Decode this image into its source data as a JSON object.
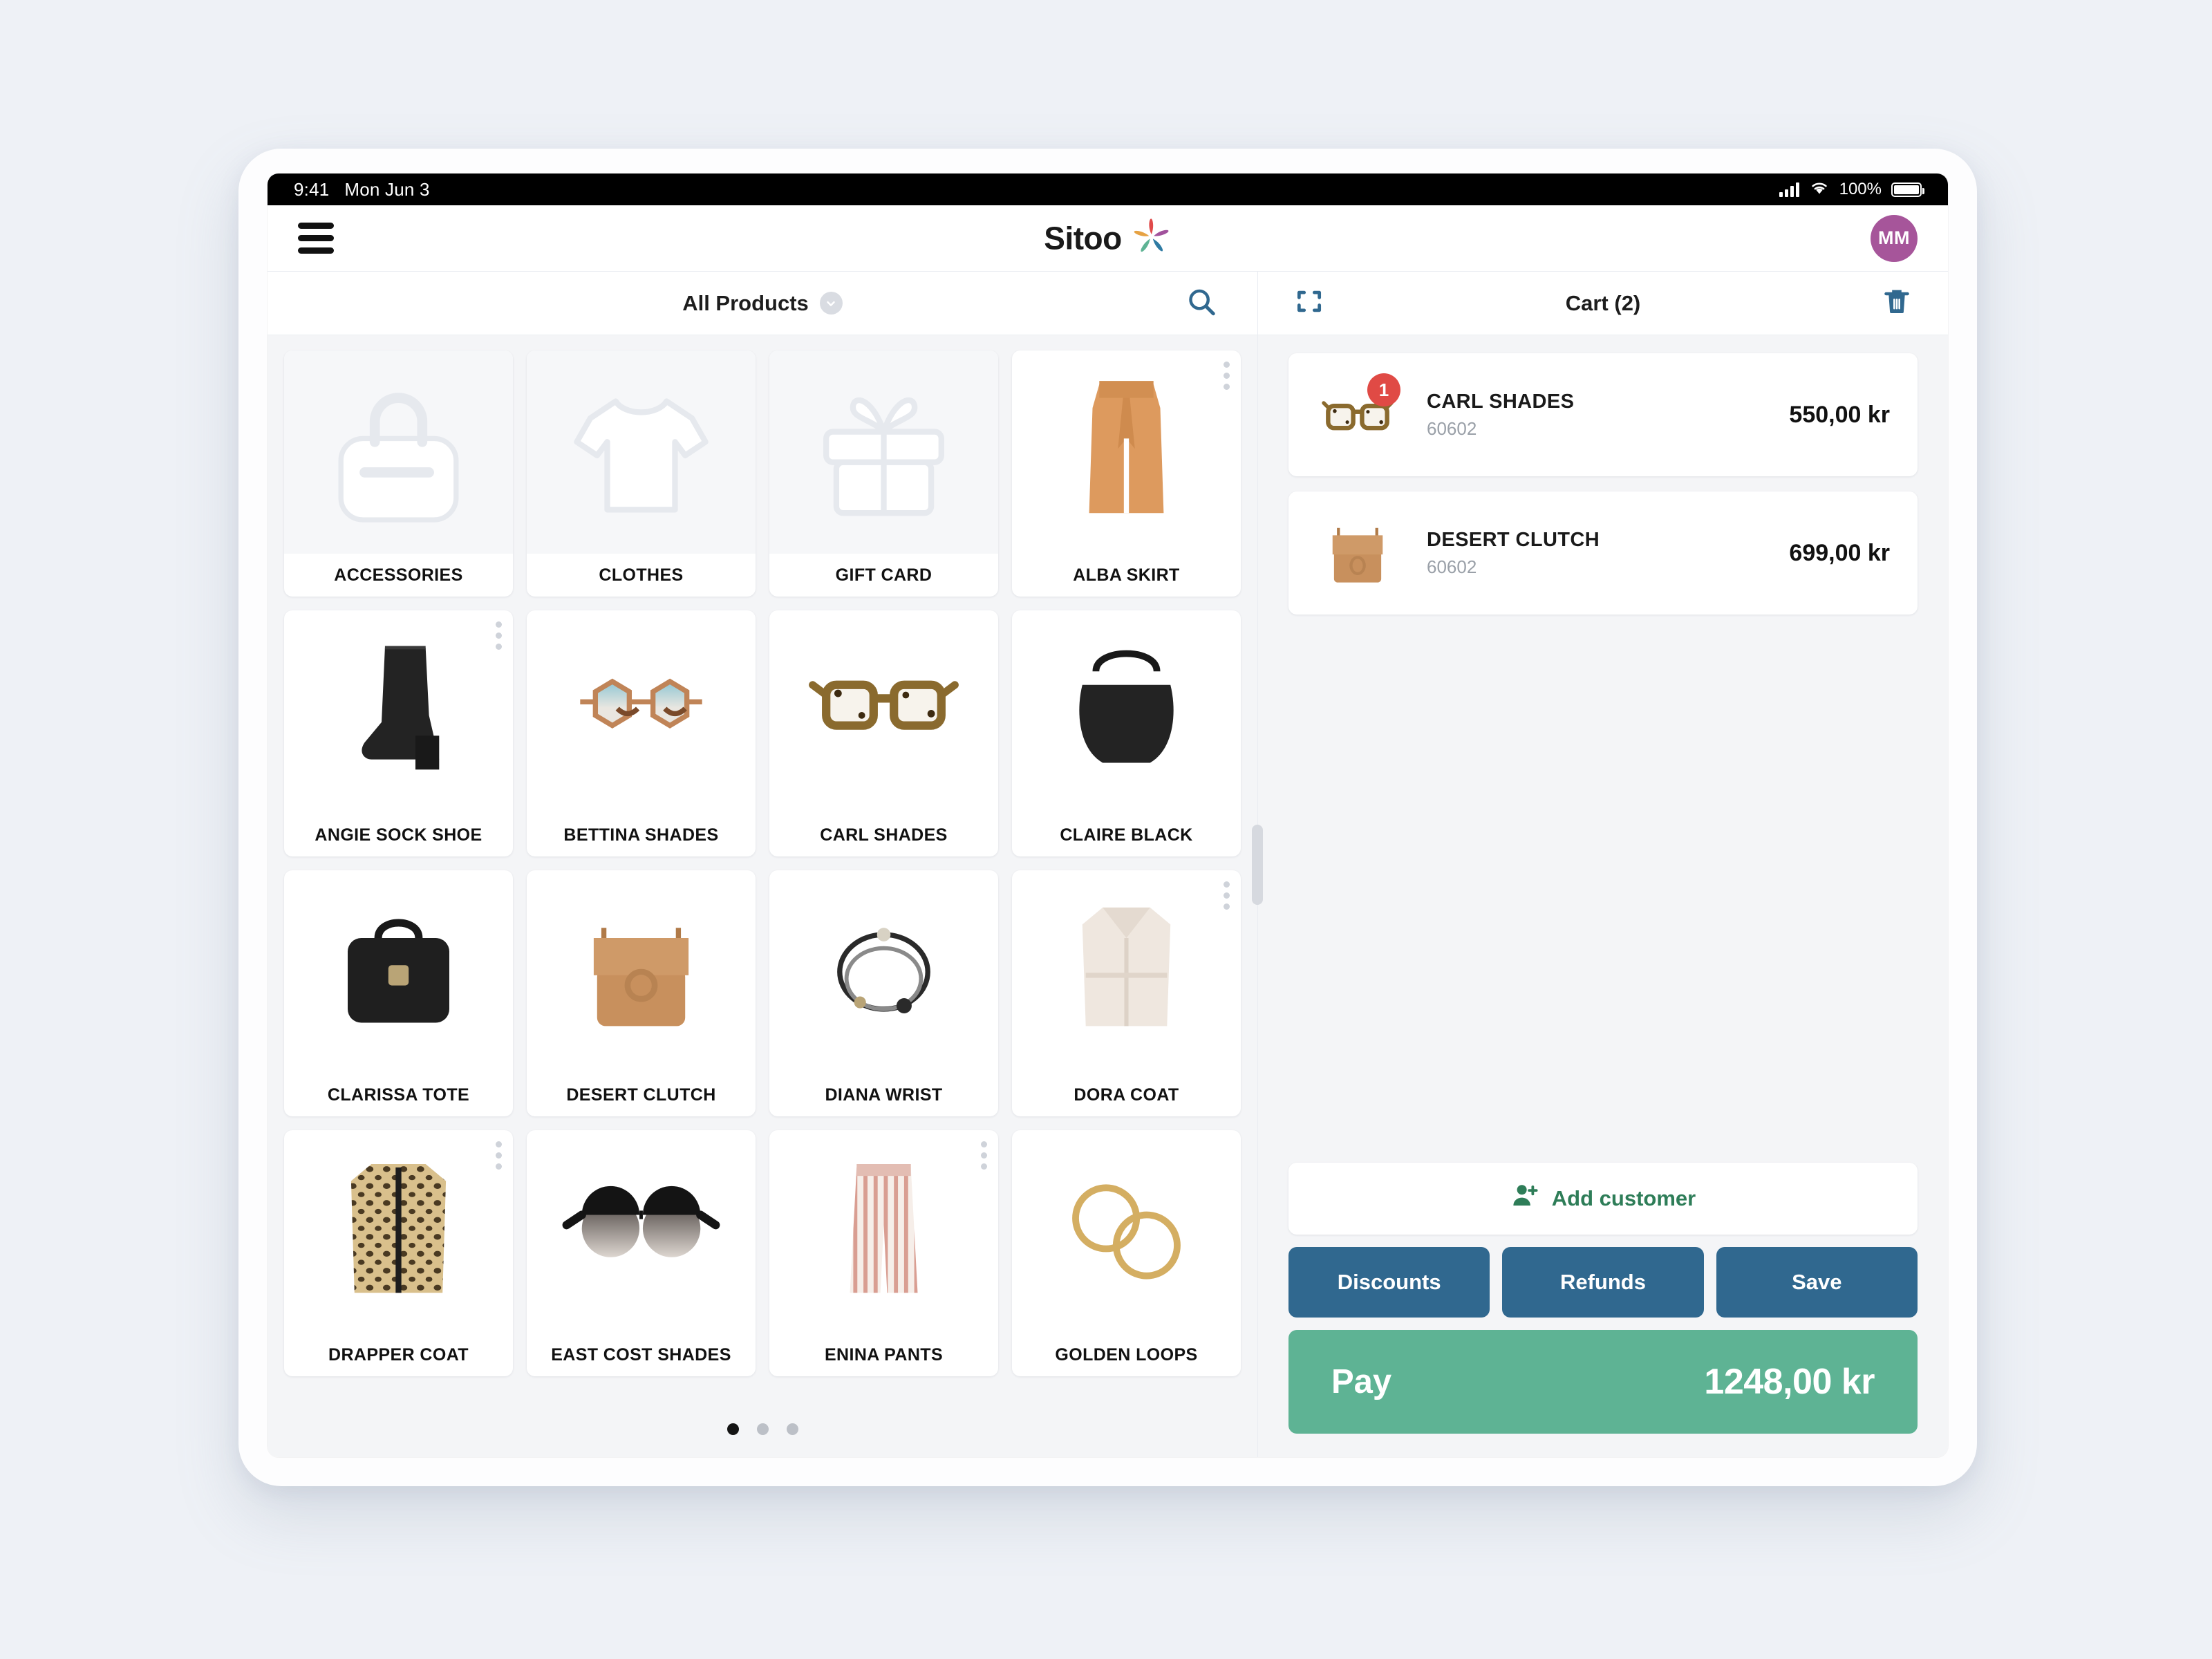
{
  "status_bar": {
    "time": "9:41",
    "date": "Mon Jun 3",
    "battery_percent": "100%"
  },
  "top_nav": {
    "brand_name": "Sitoo",
    "avatar_initials": "MM"
  },
  "product_panel": {
    "filter_label": "All Products",
    "products": [
      {
        "label": "ACCESSORIES",
        "kind": "category",
        "art": "handbag-placeholder"
      },
      {
        "label": "CLOTHES",
        "kind": "category",
        "art": "tshirt-placeholder"
      },
      {
        "label": "GIFT CARD",
        "kind": "category",
        "art": "gift-placeholder"
      },
      {
        "label": "ALBA SKIRT",
        "kind": "product",
        "art": "orange-skirt"
      },
      {
        "label": "ANGIE SOCK SHOE",
        "kind": "product",
        "art": "black-boot"
      },
      {
        "label": "BETTINA SHADES",
        "kind": "product",
        "art": "hex-sunglasses"
      },
      {
        "label": "CARL SHADES",
        "kind": "product",
        "art": "tortoise-glasses"
      },
      {
        "label": "CLAIRE BLACK",
        "kind": "product",
        "art": "black-hobo-bag"
      },
      {
        "label": "CLARISSA TOTE",
        "kind": "product",
        "art": "black-tote-bag"
      },
      {
        "label": "DESERT CLUTCH",
        "kind": "product",
        "art": "tan-clutch-bag"
      },
      {
        "label": "DIANA WRIST",
        "kind": "product",
        "art": "bracelet"
      },
      {
        "label": "DORA COAT",
        "kind": "product",
        "art": "cream-coat"
      },
      {
        "label": "DRAPPER COAT",
        "kind": "product",
        "art": "leopard-coat"
      },
      {
        "label": "EAST COST SHADES",
        "kind": "product",
        "art": "black-round-sunglasses"
      },
      {
        "label": "ENINA PANTS",
        "kind": "product",
        "art": "striped-pants"
      },
      {
        "label": "GOLDEN LOOPS",
        "kind": "product",
        "art": "gold-hoop-earrings"
      }
    ],
    "pagination": {
      "pages": 3,
      "active": 1
    }
  },
  "cart": {
    "title": "Cart (2)",
    "items": [
      {
        "name": "CARL SHADES",
        "sku": "60602",
        "price": "550,00 kr",
        "qty": "1",
        "art": "tortoise-glasses"
      },
      {
        "name": "DESERT CLUTCH",
        "sku": "60602",
        "price": "699,00 kr",
        "qty": "",
        "art": "tan-clutch-bag"
      }
    ],
    "add_customer_label": "Add customer",
    "buttons": [
      {
        "label": "Discounts"
      },
      {
        "label": "Refunds"
      },
      {
        "label": "Save"
      }
    ],
    "pay_label": "Pay",
    "pay_amount": "1248,00 kr"
  },
  "colors": {
    "page_bg": "#eef1f6",
    "panel_bg": "#f4f5f7",
    "accent_blue": "#30688f",
    "accent_green": "#5eb394",
    "text_green": "#2e7d58",
    "badge_red": "#e04a45",
    "avatar_purple": "#a6559a"
  }
}
